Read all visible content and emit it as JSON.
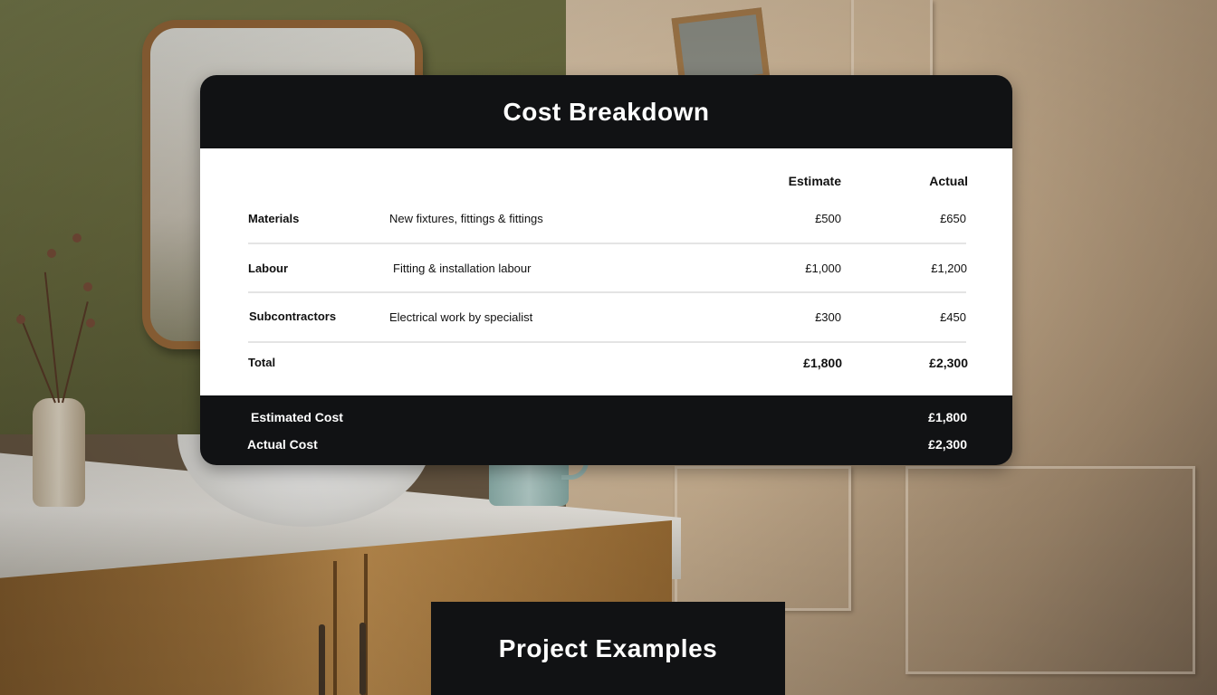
{
  "cost_card": {
    "title": "Cost Breakdown",
    "columns": {
      "estimate": "Estimate",
      "actual": "Actual"
    },
    "rows": [
      {
        "category": "Materials",
        "description": "New fixtures, fittings & fittings",
        "estimate": "£500",
        "actual": "£650"
      },
      {
        "category": "Labour",
        "description": "Fitting & installation labour",
        "estimate": "£1,000",
        "actual": "£1,200"
      },
      {
        "category": "Subcontractors",
        "description": "Electrical work by specialist",
        "estimate": "£300",
        "actual": "£450"
      }
    ],
    "total": {
      "label": "Total",
      "estimate": "£1,800",
      "actual": "£2,300"
    },
    "summary": [
      {
        "label": "Estimated Cost",
        "value": "£1,800"
      },
      {
        "label": "Actual Cost",
        "value": "£2,300"
      }
    ]
  },
  "banner": {
    "title": "Project Examples"
  },
  "colors": {
    "dark": "#111214",
    "light": "#ffffff",
    "divider": "#e4e4e4"
  }
}
